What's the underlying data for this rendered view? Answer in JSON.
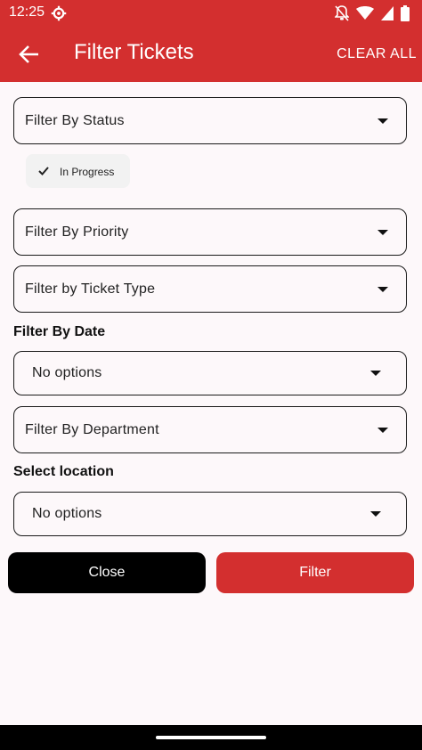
{
  "status_bar": {
    "time": "12:25"
  },
  "header": {
    "title": "Filter Tickets",
    "clear_all": "CLEAR ALL"
  },
  "filters": {
    "status": {
      "label": "Filter By Status",
      "selected_chip": "In Progress"
    },
    "priority": {
      "label": "Filter By Priority"
    },
    "ticket_type": {
      "label": "Filter by Ticket Type"
    },
    "date": {
      "section_label": "Filter By Date",
      "value": "No options"
    },
    "department": {
      "label": "Filter By Department"
    },
    "location": {
      "section_label": "Select location",
      "value": "No options"
    }
  },
  "actions": {
    "close_label": "Close",
    "filter_label": "Filter"
  },
  "colors": {
    "accent": "#d32f2f",
    "background": "#fdf8fa",
    "chip_bg": "#f2f2f2"
  }
}
